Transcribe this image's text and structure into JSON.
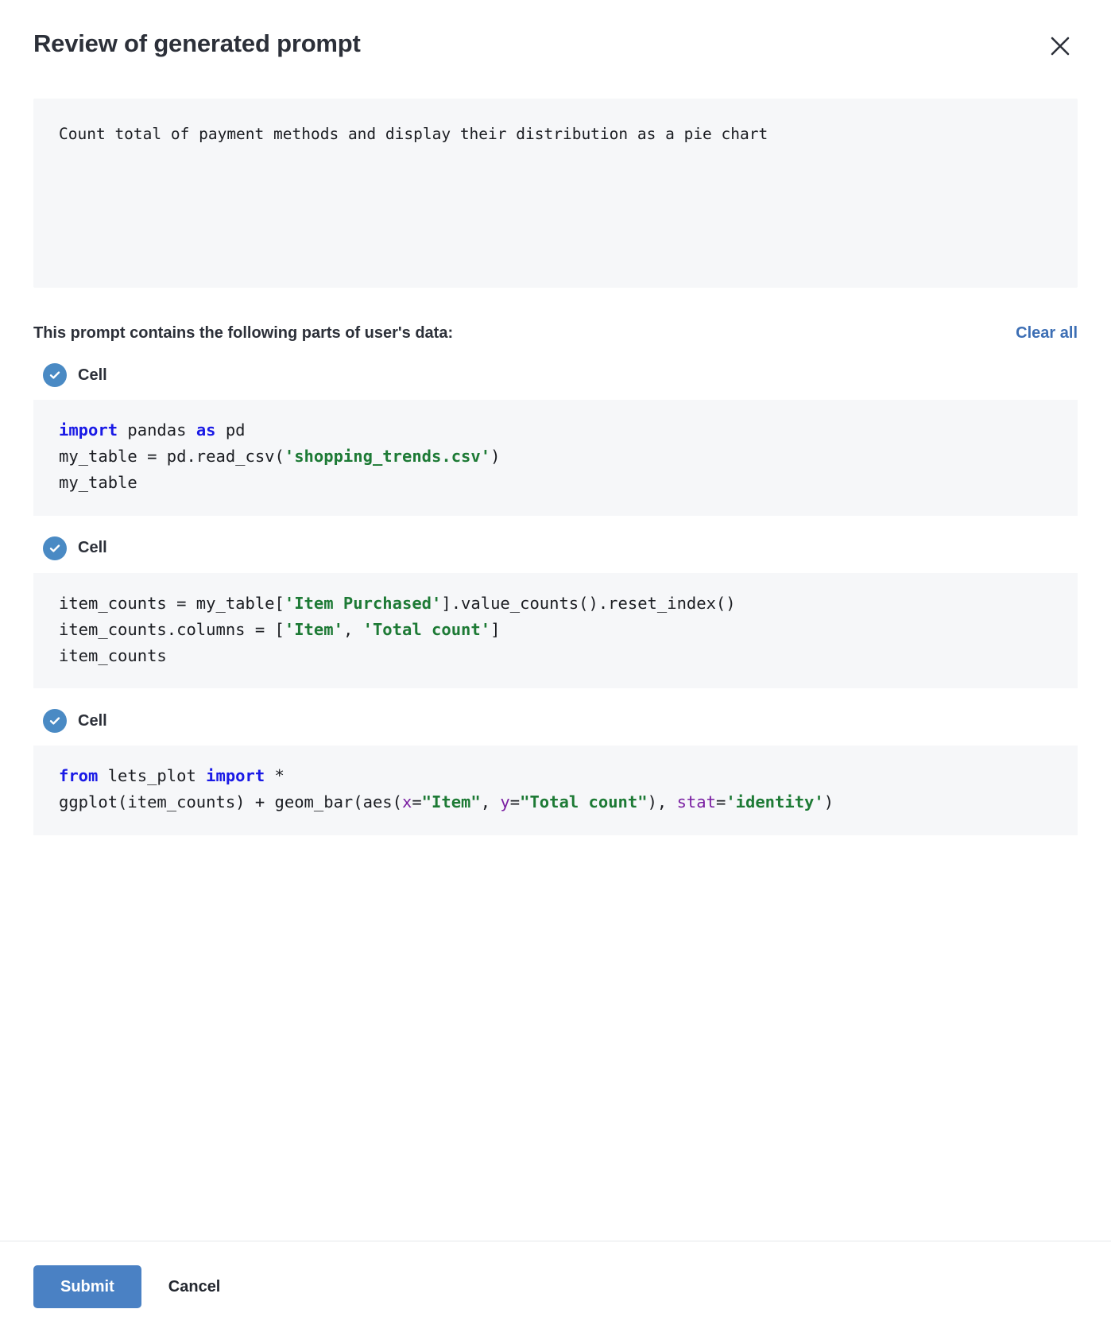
{
  "dialog": {
    "title": "Review of generated prompt",
    "close_icon": "close-icon"
  },
  "prompt": {
    "text": "Count total of payment methods and display their distribution as a pie chart"
  },
  "parts": {
    "label": "This prompt contains the following parts of user's data:",
    "clear_all_label": "Clear all"
  },
  "cells": [
    {
      "name": "Cell",
      "checked": true,
      "check_icon": "check-circle-icon",
      "code_lines": [
        [
          {
            "t": "import",
            "c": "k"
          },
          {
            "t": " pandas ",
            "c": ""
          },
          {
            "t": "as",
            "c": "k"
          },
          {
            "t": " pd",
            "c": ""
          }
        ],
        [
          {
            "t": "my_table = pd.read_csv(",
            "c": ""
          },
          {
            "t": "'shopping_trends.csv'",
            "c": "s"
          },
          {
            "t": ")",
            "c": ""
          }
        ],
        [
          {
            "t": "my_table",
            "c": ""
          }
        ]
      ]
    },
    {
      "name": "Cell",
      "checked": true,
      "check_icon": "check-circle-icon",
      "code_lines": [
        [
          {
            "t": "item_counts = my_table[",
            "c": ""
          },
          {
            "t": "'Item Purchased'",
            "c": "s"
          },
          {
            "t": "].value_counts().reset_index()",
            "c": ""
          }
        ],
        [
          {
            "t": "item_counts.columns = [",
            "c": ""
          },
          {
            "t": "'Item'",
            "c": "s"
          },
          {
            "t": ", ",
            "c": ""
          },
          {
            "t": "'Total count'",
            "c": "s"
          },
          {
            "t": "]",
            "c": ""
          }
        ],
        [
          {
            "t": "item_counts",
            "c": ""
          }
        ]
      ]
    },
    {
      "name": "Cell",
      "checked": true,
      "check_icon": "check-circle-icon",
      "code_lines": [
        [
          {
            "t": "from",
            "c": "k"
          },
          {
            "t": " lets_plot ",
            "c": ""
          },
          {
            "t": "import",
            "c": "k"
          },
          {
            "t": " *",
            "c": ""
          }
        ],
        [
          {
            "t": "ggplot(item_counts) + geom_bar(aes(",
            "c": ""
          },
          {
            "t": "x",
            "c": "kw"
          },
          {
            "t": "=",
            "c": ""
          },
          {
            "t": "\"Item\"",
            "c": "s"
          },
          {
            "t": ", ",
            "c": ""
          },
          {
            "t": "y",
            "c": "kw"
          },
          {
            "t": "=",
            "c": ""
          },
          {
            "t": "\"Total count\"",
            "c": "s"
          },
          {
            "t": "), ",
            "c": ""
          },
          {
            "t": "stat",
            "c": "kw"
          },
          {
            "t": "=",
            "c": ""
          },
          {
            "t": "'identity'",
            "c": "s"
          },
          {
            "t": ")",
            "c": ""
          }
        ]
      ]
    }
  ],
  "footer": {
    "submit_label": "Submit",
    "cancel_label": "Cancel"
  },
  "colors": {
    "accent": "#4a81c4",
    "link": "#3c6eb4",
    "checkbox": "#4a8ac4",
    "code_bg": "#f6f7f9",
    "keyword": "#1a1ae6",
    "string": "#1d7a35",
    "kwarg": "#7a1fa2",
    "text": "#2c3039"
  }
}
